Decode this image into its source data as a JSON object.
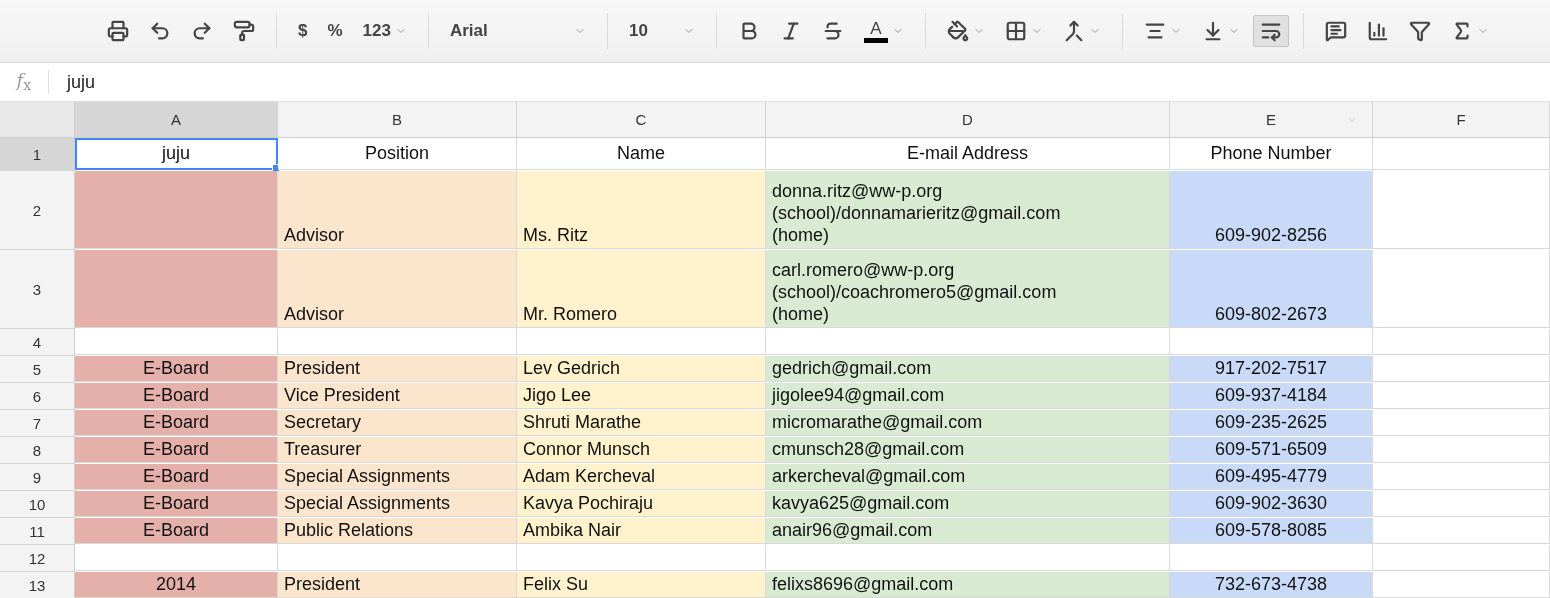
{
  "toolbar": [
    {
      "kind": "icon"
    },
    {
      "kind": "icon"
    },
    {
      "kind": "icon"
    },
    {
      "kind": "icon"
    },
    {
      "kind": "separator"
    },
    {
      "kind": "text",
      "label": "$"
    },
    {
      "kind": "text",
      "label": "%"
    },
    {
      "kind": "text",
      "label": "123",
      "dropdown": true
    },
    {
      "kind": "separator"
    },
    {
      "kind": "font",
      "label": "Arial",
      "dropdown": true
    },
    {
      "kind": "separator"
    },
    {
      "kind": "font",
      "label": "10",
      "dropdown": true
    },
    {
      "kind": "separator"
    },
    {
      "kind": "icon"
    },
    {
      "kind": "icon"
    },
    {
      "kind": "icon"
    },
    {
      "kind": "text-color",
      "label": "A",
      "dropdown": true
    },
    {
      "kind": "separator"
    },
    {
      "kind": "icon",
      "dropdown": true
    },
    {
      "kind": "icon",
      "dropdown": true
    },
    {
      "kind": "icon",
      "dropdown": true
    },
    {
      "kind": "separator"
    },
    {
      "kind": "icon",
      "dropdown": true
    },
    {
      "kind": "icon",
      "dropdown": true
    },
    {
      "kind": "icon",
      "selected": true
    },
    {
      "kind": "separator"
    },
    {
      "kind": "icon"
    },
    {
      "kind": "icon"
    },
    {
      "kind": "icon"
    },
    {
      "kind": "icon",
      "dropdown": true
    }
  ],
  "formula_bar": {
    "label": "*f*$_{x}$",
    "value": "juju"
  },
  "columns": [
    {
      "label": "A",
      "selected": true,
      "color": "#e6b0aa"
    },
    {
      "label": "B",
      "selected": false,
      "color": "#fce5cd"
    },
    {
      "label": "C",
      "selected": false,
      "color": "#fff2cc"
    },
    {
      "label": "D",
      "selected": false,
      "color": "#d9ead3"
    },
    {
      "label": "E",
      "selected": false,
      "color": "#c9daf8",
      "filter": true
    },
    {
      "label": "F",
      "selected": false
    }
  ],
  "rows": [
    {
      "number": "1",
      "selected": true,
      "filled": false,
      "cells": {
        "A": "juju",
        "B": "Position",
        "C": "Name",
        "D": "E-mail Address",
        "E": "Phone Number"
      }
    },
    {
      "number": "2",
      "selected": false,
      "filled": true,
      "tall": true,
      "cells": {
        "B": "Advisor",
        "C": "Ms. Ritz",
        "D": "donna.ritz@ww-p.org\n(school)/donnamarieritz@gmail.com\n(home)",
        "E": "609-902-8256"
      }
    },
    {
      "number": "3",
      "selected": false,
      "filled": true,
      "tall": true,
      "cells": {
        "B": "Advisor",
        "C": "Mr. Romero",
        "D": "carl.romero@ww-p.org\n(school)/coachromero5@gmail.com\n(home)",
        "E": "609-802-2673"
      }
    },
    {
      "number": "4",
      "selected": false,
      "filled": false,
      "cells": {}
    },
    {
      "number": "5",
      "selected": false,
      "filled": true,
      "cells": {
        "A": "E-Board",
        "B": "President",
        "C": "Lev Gedrich",
        "D": "gedrich@gmail.com",
        "E": "917-202-7517"
      }
    },
    {
      "number": "6",
      "selected": false,
      "filled": true,
      "cells": {
        "A": "E-Board",
        "B": "Vice President",
        "C": "Jigo Lee",
        "D": "jigolee94@gmail.com",
        "E": "609-937-4184"
      }
    },
    {
      "number": "7",
      "selected": false,
      "filled": true,
      "cells": {
        "A": "E-Board",
        "B": "Secretary",
        "C": "Shruti Marathe",
        "D": "micromarathe@gmail.com",
        "E": "609-235-2625"
      }
    },
    {
      "number": "8",
      "selected": false,
      "filled": true,
      "cells": {
        "A": "E-Board",
        "B": "Treasurer",
        "C": "Connor Munsch",
        "D": "cmunsch28@gmail.com",
        "E": "609-571-6509"
      }
    },
    {
      "number": "9",
      "selected": false,
      "filled": true,
      "cells": {
        "A": "E-Board",
        "B": "Special Assignments",
        "C": "Adam Kercheval",
        "D": "arkercheval@gmail.com",
        "E": "609-495-4779"
      }
    },
    {
      "number": "10",
      "selected": false,
      "filled": true,
      "cells": {
        "A": "E-Board",
        "B": "Special Assignments",
        "C": "Kavya Pochiraju",
        "D": "kavya625@gmail.com",
        "E": "609-902-3630"
      }
    },
    {
      "number": "11",
      "selected": false,
      "filled": true,
      "cells": {
        "A": "E-Board",
        "B": "Public Relations",
        "C": "Ambika Nair",
        "D": "anair96@gmail.com",
        "E": "609-578-8085"
      }
    },
    {
      "number": "12",
      "selected": false,
      "filled": false,
      "cells": {}
    },
    {
      "number": "13",
      "selected": false,
      "filled": true,
      "cells": {
        "A": "2014",
        "B": "President",
        "C": "Felix Su",
        "D": "felixs8696@gmail.com",
        "E": "732-673-4738"
      }
    }
  ]
}
